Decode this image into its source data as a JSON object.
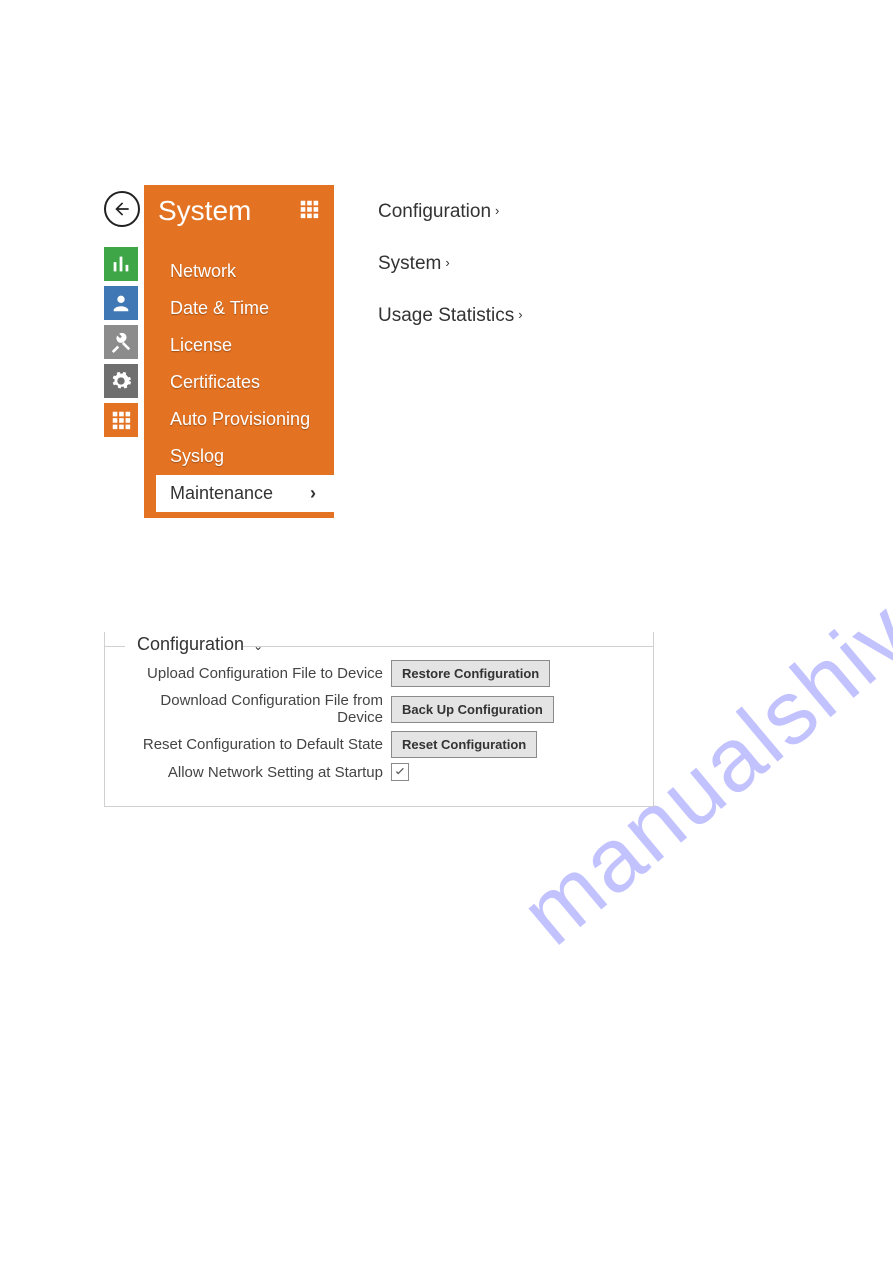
{
  "watermark": "manualshive.com",
  "sidebar": {
    "title": "System",
    "items": [
      {
        "label": "Network"
      },
      {
        "label": "Date & Time"
      },
      {
        "label": "License"
      },
      {
        "label": "Certificates"
      },
      {
        "label": "Auto Provisioning"
      },
      {
        "label": "Syslog"
      },
      {
        "label": "Maintenance",
        "active": true
      }
    ]
  },
  "icon_rail": {
    "items": [
      "stats",
      "users",
      "tools",
      "gear",
      "grid"
    ]
  },
  "right_links": [
    {
      "label": "Configuration"
    },
    {
      "label": "System"
    },
    {
      "label": "Usage Statistics"
    }
  ],
  "config_panel": {
    "legend": "Configuration",
    "rows": {
      "upload": {
        "label": "Upload Configuration File to Device",
        "button": "Restore Configuration"
      },
      "download": {
        "label": "Download Configuration File from Device",
        "button": "Back Up Configuration"
      },
      "reset": {
        "label": "Reset Configuration to Default State",
        "button": "Reset Configuration"
      },
      "allow": {
        "label": "Allow Network Setting at Startup",
        "checked": true
      }
    }
  }
}
